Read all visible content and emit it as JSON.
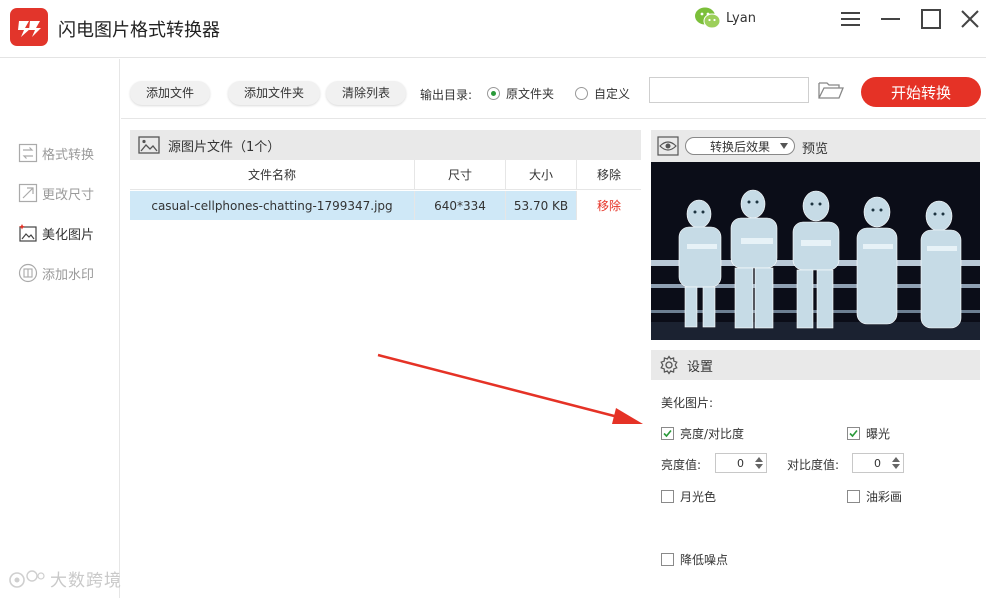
{
  "app": {
    "title": "闪电图片格式转换器"
  },
  "user": {
    "name": "Lyan"
  },
  "sidebar": {
    "items": [
      {
        "label": "格式转换"
      },
      {
        "label": "更改尺寸"
      },
      {
        "label": "美化图片"
      },
      {
        "label": "添加水印"
      }
    ]
  },
  "toolbar": {
    "add_file": "添加文件",
    "add_folder": "添加文件夹",
    "clear_list": "清除列表",
    "output_dir_label": "输出目录:",
    "radio_original": "原文件夹",
    "radio_custom": "自定义",
    "path_value": "",
    "start": "开始转换"
  },
  "source_panel": {
    "title": "源图片文件（1个）",
    "columns": [
      "文件名称",
      "尺寸",
      "大小",
      "移除"
    ],
    "rows": [
      {
        "name": "casual-cellphones-chatting-1799347.jpg",
        "size": "640*334",
        "filesize": "53.70 KB",
        "action": "移除"
      }
    ]
  },
  "preview": {
    "mode": "转换后效果",
    "label": "预览"
  },
  "settings": {
    "title": "设置",
    "section": "美化图片:",
    "brightness_contrast": {
      "label": "亮度/对比度",
      "checked": true
    },
    "exposure": {
      "label": "曝光",
      "checked": true
    },
    "brightness_value_label": "亮度值:",
    "brightness_value": "0",
    "contrast_value_label": "对比度值:",
    "contrast_value": "0",
    "moonlight": {
      "label": "月光色",
      "checked": false
    },
    "oil_painting": {
      "label": "油彩画",
      "checked": false
    },
    "denoise": {
      "label": "降低噪点",
      "checked": false
    }
  },
  "watermark": {
    "text": "大数跨境"
  },
  "colors": {
    "accent": "#e53226",
    "selected_row": "#cfe8f7",
    "check_green": "#2a9a3a"
  }
}
